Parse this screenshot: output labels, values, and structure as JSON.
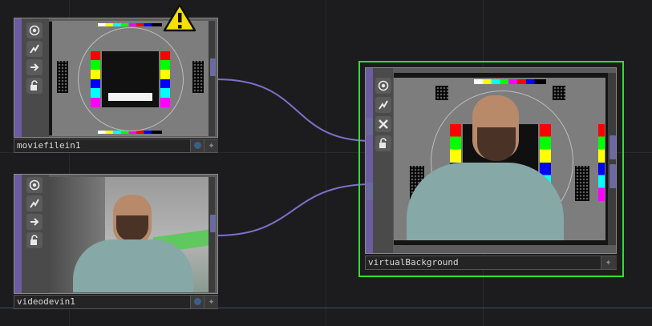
{
  "nodes": [
    {
      "name": "moviefilein1",
      "warning": true
    },
    {
      "name": "videodevin1",
      "warning": false
    },
    {
      "name": "virtualBackground",
      "warning": false,
      "selected": true
    }
  ],
  "flags": {
    "viewer": "viewer-icon",
    "bypass": "bypass-icon",
    "display": "display-arrow-icon",
    "lock": "lock-icon",
    "clone": "close-x-icon"
  },
  "colors": {
    "background": "#1c1c1f",
    "node_strip": "#6b5da0",
    "wire": "#8070c8",
    "selection": "#2fe02f",
    "warning": "#f5e000"
  }
}
